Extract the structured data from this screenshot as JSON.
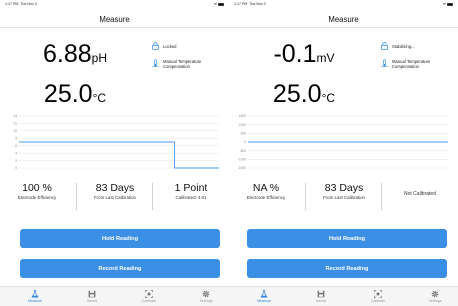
{
  "status_bar": {
    "left": {
      "time": "1:17 PM",
      "date": "Tue Nov 3"
    },
    "right": {
      "time": "1:17 PM",
      "date": "Tue Nov 3"
    }
  },
  "screens": [
    {
      "title": "Measure",
      "primary_value": "6.88",
      "primary_unit": "pH",
      "temperature_value": "25.0",
      "temperature_unit": "°C",
      "lock_status": "Locked",
      "temp_comp_label": "Manual Temperature Compensation",
      "chart_y_ticks": [
        "14",
        "12",
        "10",
        "8",
        "6",
        "4",
        "2",
        "0"
      ],
      "efficiency_value": "100 %",
      "efficiency_label": "Electrode Efficiency",
      "days_value": "83 Days",
      "days_label": "From Last Calibration",
      "points_value": "1 Point",
      "points_label": "Calibrated: 4.01",
      "hold_label": "Hold Reading",
      "record_label": "Record Reading"
    },
    {
      "title": "Measure",
      "primary_value": "-0.1",
      "primary_unit": "mV",
      "temperature_value": "25.0",
      "temperature_unit": "°C",
      "lock_status": "Stabilizing...",
      "temp_comp_label": "Manual Temperature Compensation",
      "chart_y_ticks": [
        "1500",
        "1000",
        "500",
        "0",
        "-500",
        "-1000",
        "-1500"
      ],
      "efficiency_value": "NA %",
      "efficiency_label": "Electrode Efficiency",
      "days_value": "83 Days",
      "days_label": "From Last Calibration",
      "points_value": "Not Calibrated",
      "hold_label": "Hold Reading",
      "record_label": "Record Reading"
    }
  ],
  "tabs": [
    "Measure",
    "Saved",
    "Calibrate",
    "Settings"
  ],
  "active_tab": "Measure",
  "colors": {
    "accent": "#3b8fe4",
    "chart_line": "#4a98e8"
  },
  "chart_data": [
    {
      "type": "line",
      "ylim": [
        0,
        14
      ],
      "series": [
        {
          "values": [
            7,
            7,
            7,
            7,
            7,
            7,
            7,
            0,
            0,
            0
          ]
        }
      ]
    },
    {
      "type": "line",
      "ylim": [
        -1500,
        1500
      ],
      "series": [
        {
          "values": [
            0,
            0,
            0,
            0,
            0,
            0,
            0,
            0,
            0,
            0
          ]
        }
      ]
    }
  ]
}
